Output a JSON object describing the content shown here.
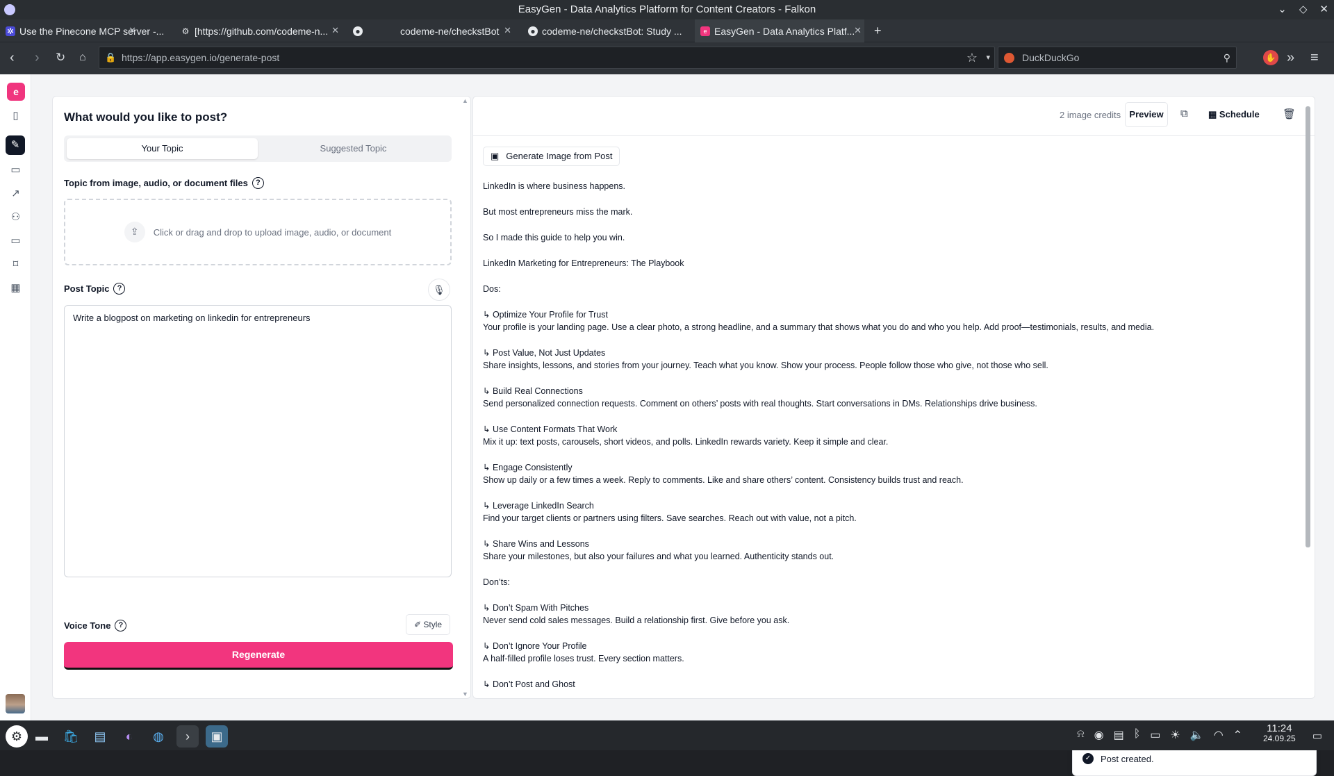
{
  "window": {
    "title": "EasyGen - Data Analytics Platform for Content Creators - Falkon"
  },
  "tabs": [
    {
      "label": "Use the Pinecone MCP server -..."
    },
    {
      "label": "[https://github.com/codeme-n..."
    },
    {
      "label": ""
    },
    {
      "label": "codeme-ne/checkstBot"
    },
    {
      "label": "codeme-ne/checkstBot: Study ..."
    },
    {
      "label": "EasyGen - Data Analytics Platf..."
    }
  ],
  "nav": {
    "url": "https://app.easygen.io/generate-post",
    "search_placeholder": "DuckDuckGo"
  },
  "sidebar": {
    "logo": "e"
  },
  "left": {
    "heading": "What would you like to post?",
    "tab_your_topic": "Your Topic",
    "tab_suggested": "Suggested Topic",
    "files_label": "Topic from image, audio, or document files",
    "upload_text": "Click or drag and drop to upload image, audio, or document",
    "post_topic_label": "Post Topic",
    "post_topic_value": "Write a blogpost on marketing on linkedin for entrepreneurs",
    "voice_tone_label": "Voice Tone",
    "style_label": "Style",
    "regenerate_label": "Regenerate"
  },
  "right": {
    "credits": "2 image credits",
    "preview_label": "Preview",
    "schedule_label": "Schedule",
    "gen_image_label": "Generate Image from Post",
    "post_lines": [
      "LinkedIn is where business happens.",
      "",
      "But most entrepreneurs miss the mark.",
      "",
      "So I made this guide to help you win.",
      "",
      "LinkedIn Marketing for Entrepreneurs: The Playbook",
      "",
      "Dos:",
      "",
      "↳ Optimize Your Profile for Trust",
      "Your profile is your landing page. Use a clear photo, a strong headline, and a summary that shows what you do and who you help. Add proof—testimonials, results, and media.",
      "",
      "↳ Post Value, Not Just Updates",
      "Share insights, lessons, and stories from your journey. Teach what you know. Show your process. People follow those who give, not those who sell.",
      "",
      "↳ Build Real Connections",
      "Send personalized connection requests. Comment on others’ posts with real thoughts. Start conversations in DMs. Relationships drive business.",
      "",
      "↳ Use Content Formats That Work",
      "Mix it up: text posts, carousels, short videos, and polls. LinkedIn rewards variety. Keep it simple and clear.",
      "",
      "↳ Engage Consistently",
      "Show up daily or a few times a week. Reply to comments. Like and share others’ content. Consistency builds trust and reach.",
      "",
      "↳ Leverage LinkedIn Search",
      "Find your target clients or partners using filters. Save searches. Reach out with value, not a pitch.",
      "",
      "↳ Share Wins and Lessons",
      "Share your milestones, but also your failures and what you learned. Authenticity stands out.",
      "",
      "Don’ts:",
      "",
      "↳ Don’t Spam With Pitches",
      "Never send cold sales messages. Build a relationship first. Give before you ask.",
      "",
      "↳ Don’t Ignore Your Profile",
      "A half-filled profile loses trust. Every section matters.",
      "",
      "↳ Don’t Post and Ghost"
    ]
  },
  "toast": {
    "message": "Post created."
  },
  "taskbar": {
    "time": "11:24",
    "date": "24.09.25"
  },
  "colors": {
    "accent": "#f2357e",
    "dark": "#111827"
  }
}
